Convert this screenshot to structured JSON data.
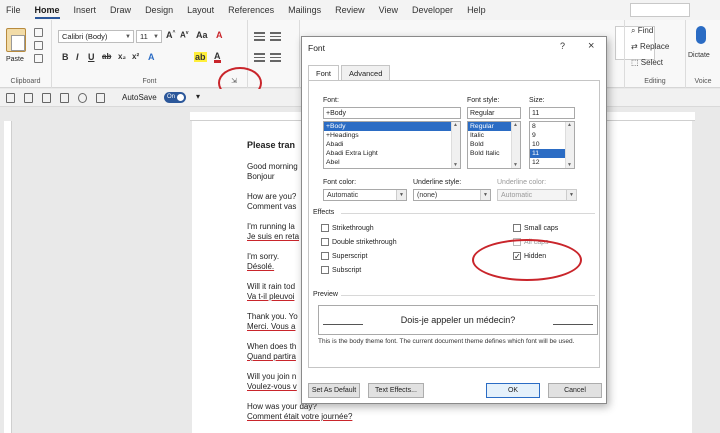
{
  "ribbon": {
    "tabs": [
      "File",
      "Home",
      "Insert",
      "Draw",
      "Design",
      "Layout",
      "References",
      "Mailings",
      "Review",
      "View",
      "Developer",
      "Help"
    ],
    "active_tab": "Home",
    "paste_label": "Paste",
    "clipboard_label": "Clipboard",
    "font_group_label": "Font",
    "font_name": "Calibri (Body)",
    "font_size": "11",
    "find_label": "Find",
    "replace_label": "Replace",
    "select_label": "Select",
    "editing_label": "Editing",
    "dictate_label": "Dictate",
    "voice_label": "Voice"
  },
  "qat": {
    "autosave_label": "AutoSave",
    "autosave_state": "On"
  },
  "document": {
    "title": "Please tran",
    "pairs": [
      {
        "en": "Good morning",
        "fr": "Bonjour"
      },
      {
        "en": "How are you?",
        "fr": "Comment vas"
      },
      {
        "en": "I'm running la",
        "fr": "Je suis en reta"
      },
      {
        "en": "I'm sorry.",
        "fr": "Désolé."
      },
      {
        "en": "Will it rain tod",
        "fr": "Va t-il pleuvoi"
      },
      {
        "en": "Thank you. Yo",
        "fr": "Merci. Vous a"
      },
      {
        "en": "When does th",
        "fr": "Quand partira"
      },
      {
        "en": "Will you join n",
        "fr": "Voulez-vous v"
      },
      {
        "en": "How was your day?",
        "fr": "Comment était votre journée?"
      }
    ]
  },
  "dialog": {
    "title": "Font",
    "help": "?",
    "close": "×",
    "tabs": [
      "Font",
      "Advanced"
    ],
    "font_label": "Font:",
    "font_value": "+Body",
    "font_list": [
      "+Body",
      "+Headings",
      "Abadi",
      "Abadi Extra Light",
      "Abel"
    ],
    "style_label": "Font style:",
    "style_value": "Regular",
    "style_list": [
      "Regular",
      "Italic",
      "Bold",
      "Bold Italic"
    ],
    "size_label": "Size:",
    "size_value": "11",
    "size_list": [
      "8",
      "9",
      "10",
      "11",
      "12"
    ],
    "font_color_label": "Font color:",
    "font_color_value": "Automatic",
    "underline_style_label": "Underline style:",
    "underline_style_value": "(none)",
    "underline_color_label": "Underline color:",
    "underline_color_value": "Automatic",
    "effects_label": "Effects",
    "effects_left": [
      "Strikethrough",
      "Double strikethrough",
      "Superscript",
      "Subscript"
    ],
    "effects_right": [
      "Small caps",
      "All caps",
      "Hidden"
    ],
    "hidden_checked": "✓",
    "preview_label": "Preview",
    "preview_text": "Dois-je appeler un médecin?",
    "preview_note": "This is the body theme font. The current document theme defines which font will be used.",
    "set_default": "Set As Default",
    "text_effects": "Text Effects...",
    "ok": "OK",
    "cancel": "Cancel"
  }
}
